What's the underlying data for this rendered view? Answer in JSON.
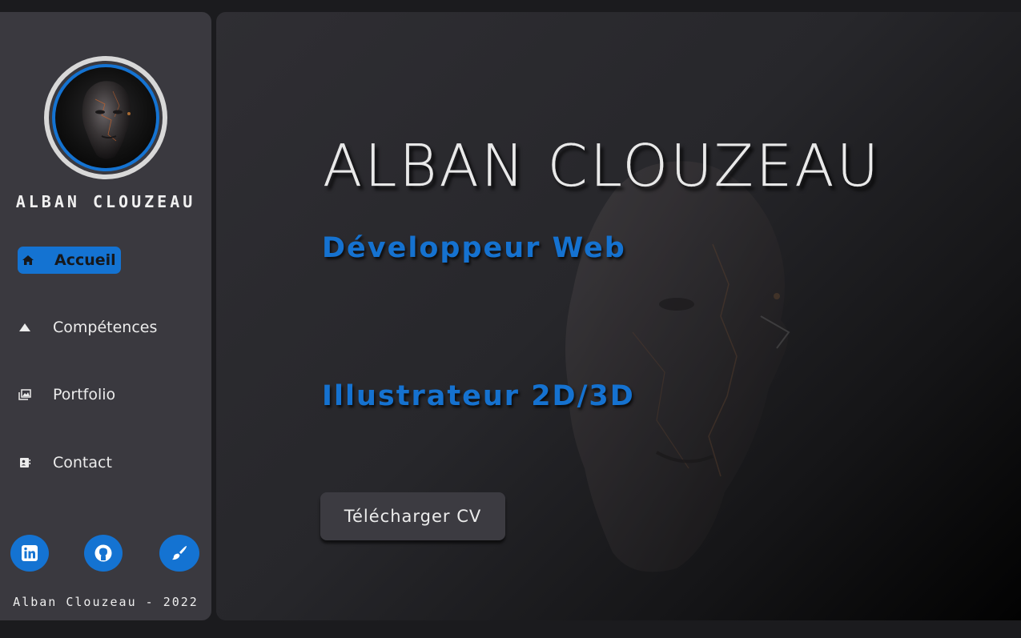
{
  "sidebar": {
    "name": "ALBAN CLOUZEAU",
    "avatar_icon": "sculpted-head-avatar",
    "nav": [
      {
        "label": "Accueil",
        "icon": "home-icon",
        "active": true
      },
      {
        "label": "Compétences",
        "icon": "triangle-icon",
        "active": false
      },
      {
        "label": "Portfolio",
        "icon": "gallery-icon",
        "active": false
      },
      {
        "label": "Contact",
        "icon": "contact-card-icon",
        "active": false
      }
    ],
    "socials": [
      {
        "icon": "linkedin-icon"
      },
      {
        "icon": "github-icon"
      },
      {
        "icon": "paintbrush-icon"
      }
    ],
    "footer": "Alban Clouzeau - 2022"
  },
  "main": {
    "title": "ALBAN CLOUZEAU",
    "role_1": "Développeur Web",
    "role_2": "Illustrateur 2D/3D",
    "cv_button": "Télécharger CV"
  },
  "colors": {
    "accent": "#1473d2",
    "sidebar_bg": "#3a393f",
    "text": "#ececec"
  }
}
